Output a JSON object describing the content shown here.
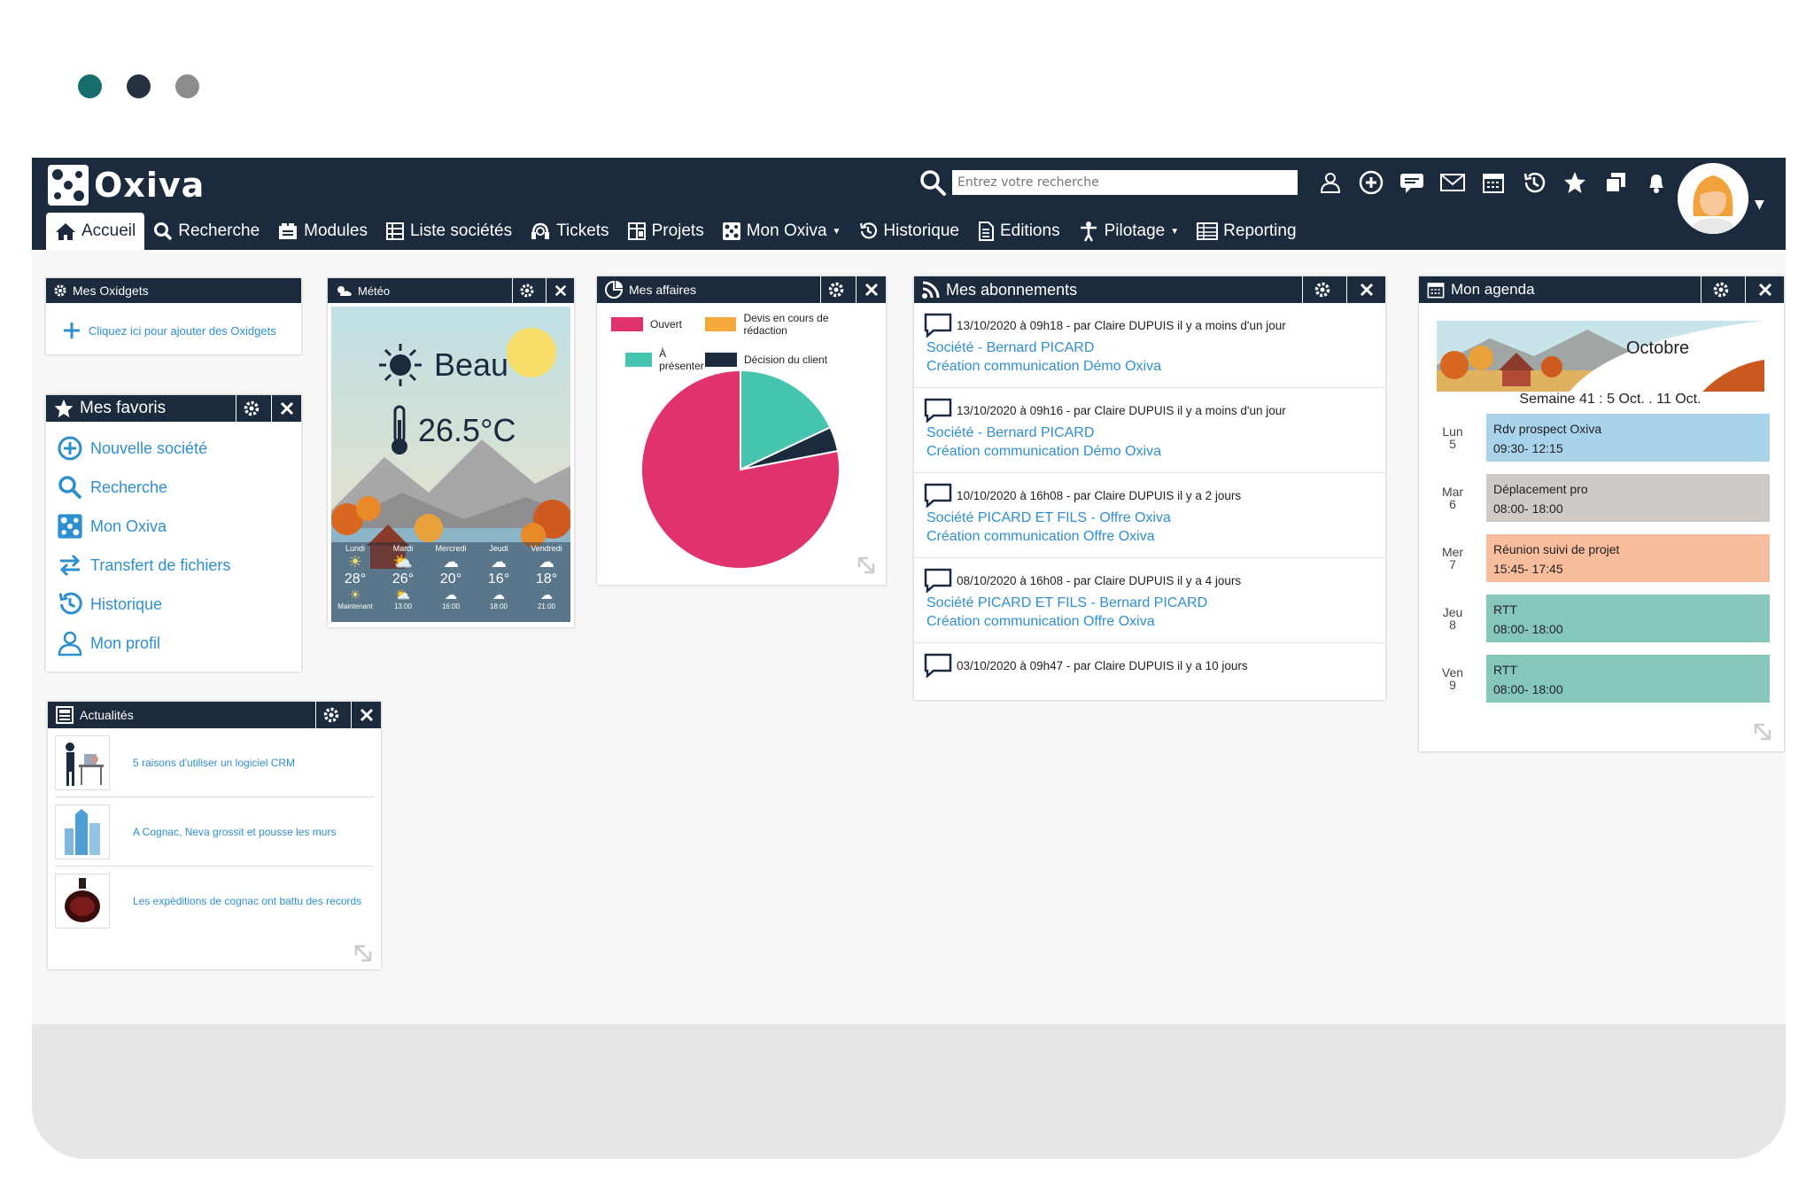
{
  "window_dots": [
    "#176c6c",
    "#263040",
    "#8c8c8c"
  ],
  "app": {
    "name": "Oxiva"
  },
  "search": {
    "placeholder": "Entrez votre recherche"
  },
  "top_icons": [
    "users-icon",
    "add-circle-icon",
    "chat-icon",
    "mail-icon",
    "calendar-icon",
    "history-icon",
    "star-icon",
    "windows-icon",
    "bell-icon"
  ],
  "nav": [
    {
      "label": "Accueil",
      "icon": "home-icon",
      "active": true
    },
    {
      "label": "Recherche",
      "icon": "search-icon"
    },
    {
      "label": "Modules",
      "icon": "modules-icon"
    },
    {
      "label": "Liste sociétés",
      "icon": "list-icon"
    },
    {
      "label": "Tickets",
      "icon": "headset-icon"
    },
    {
      "label": "Projets",
      "icon": "projects-icon"
    },
    {
      "label": "Mon Oxiva",
      "icon": "oxiva-icon",
      "dropdown": true
    },
    {
      "label": "Historique",
      "icon": "history-icon"
    },
    {
      "label": "Editions",
      "icon": "document-icon"
    },
    {
      "label": "Pilotage",
      "icon": "pilot-icon",
      "dropdown": true
    },
    {
      "label": "Reporting",
      "icon": "reporting-icon"
    }
  ],
  "oxidgets": {
    "title": "Mes Oxidgets",
    "add_label": "Cliquez ici pour ajouter des Oxidgets"
  },
  "favoris": {
    "title": "Mes favoris",
    "items": [
      {
        "label": "Nouvelle société",
        "icon": "plus-circle-icon"
      },
      {
        "label": "Recherche",
        "icon": "search-icon"
      },
      {
        "label": "Mon Oxiva",
        "icon": "oxiva-icon"
      },
      {
        "label": "Transfert de fichiers",
        "icon": "transfer-icon"
      },
      {
        "label": "Historique",
        "icon": "history-icon"
      },
      {
        "label": "Mon profil",
        "icon": "user-icon"
      }
    ]
  },
  "meteo": {
    "title": "Météo",
    "condition": "Beau",
    "temperature": "26.5°C",
    "days": [
      {
        "day": "Lundi",
        "temp": "28°",
        "time": "Maintenant"
      },
      {
        "day": "Mardi",
        "temp": "26°",
        "time": "13:00"
      },
      {
        "day": "Mercredi",
        "temp": "20°",
        "time": "16:00"
      },
      {
        "day": "Jeudi",
        "temp": "16°",
        "time": "18:00"
      },
      {
        "day": "Vendredi",
        "temp": "18°",
        "time": "21:00"
      }
    ]
  },
  "affaires": {
    "title": "Mes affaires"
  },
  "chart_data": {
    "type": "pie",
    "categories": [
      "Ouvert",
      "Devis en cours de rédaction",
      "À présenter",
      "Décision du client"
    ],
    "values": [
      78,
      0,
      18,
      4
    ],
    "colors": [
      "#e0336d",
      "#f5a83a",
      "#45c4b0",
      "#1b2a3d"
    ],
    "legend_position": "top"
  },
  "abonnements": {
    "title": "Mes abonnements",
    "items": [
      {
        "meta": "13/10/2020 à 09h18 - par Claire DUPUIS il y a moins d'un jour",
        "line1": "Société - Bernard PICARD",
        "line2": "Création communication Démo Oxiva"
      },
      {
        "meta": "13/10/2020 à 09h16 - par Claire DUPUIS il y a moins d'un jour",
        "line1": "Société - Bernard PICARD",
        "line2": "Création communication Démo Oxiva"
      },
      {
        "meta": "10/10/2020 à 16h08 - par Claire DUPUIS il y a 2 jours",
        "line1": "Société PICARD ET FILS - Offre Oxiva",
        "line2": "Création communication Offre Oxiva"
      },
      {
        "meta": "08/10/2020 à 16h08 - par Claire DUPUIS il y a 4 jours",
        "line1": "Société PICARD ET FILS - Bernard PICARD",
        "line2": "Création communication Offre Oxiva"
      },
      {
        "meta": "03/10/2020 à 09h47 - par Claire DUPUIS il y a 10 jours",
        "line1": "",
        "line2": ""
      }
    ]
  },
  "agenda": {
    "title": "Mon agenda",
    "month": "Octobre",
    "week": "Semaine 41 : 5 Oct. . 11 Oct.",
    "events": [
      {
        "day": "Lun",
        "num": "5",
        "title": "Rdv prospect Oxiva",
        "time": "09:30- 12:15",
        "color": "#a8d3ea"
      },
      {
        "day": "Mar",
        "num": "6",
        "title": "Déplacement pro",
        "time": "08:00- 18:00",
        "color": "#cfcac6"
      },
      {
        "day": "Mer",
        "num": "7",
        "title": "Réunion suivi de projet",
        "time": "15:45- 17:45",
        "color": "#f8bd9d"
      },
      {
        "day": "Jeu",
        "num": "8",
        "title": "RTT",
        "time": "08:00- 18:00",
        "color": "#85c8bb"
      },
      {
        "day": "Ven",
        "num": "9",
        "title": "RTT",
        "time": "08:00- 18:00",
        "color": "#85c8bb"
      }
    ]
  },
  "actualites": {
    "title": "Actualités",
    "items": [
      {
        "label": "5 raisons d'utiliser un logiciel CRM",
        "thumb": "office-people-icon"
      },
      {
        "label": "A Cognac, Neva grossit et pousse les murs",
        "thumb": "buildings-icon"
      },
      {
        "label": "Les expéditions de cognac ont battu des records",
        "thumb": "bottle-icon"
      }
    ]
  }
}
